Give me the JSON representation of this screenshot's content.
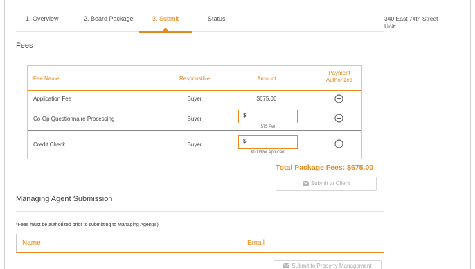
{
  "tabs": [
    {
      "label": "1. Overview",
      "active": false
    },
    {
      "label": "2. Board Package",
      "active": false
    },
    {
      "label": "3. Submit",
      "active": true
    },
    {
      "label": "Status",
      "active": false
    }
  ],
  "fees": {
    "section_title": "Fees",
    "columns": {
      "fee_name": "Fee Name",
      "responsible": "Responsible",
      "amount": "Amount",
      "payment_line1": "Payment",
      "payment_line2": "Authorized"
    },
    "rows": [
      {
        "name": "Application Fee",
        "responsible": "Buyer",
        "amount": "$675.00"
      },
      {
        "name": "Co-Op Questionnaire Processing",
        "responsible": "Buyer",
        "amount_prefix": "$",
        "amount_note": "$75 Per"
      },
      {
        "name": "Credit Check",
        "responsible": "Buyer",
        "amount_prefix": "$",
        "amount_note": "$100/Per Applicant"
      }
    ],
    "total_label": "Total Package Fees: $675.00",
    "submit_client_label": "Submit to Client"
  },
  "agent": {
    "section_title": "Managing Agent Submission",
    "note": "*Fees must be authorized prior to submitting to Managing Agent(s)",
    "columns": {
      "name": "Name",
      "email": "Email"
    },
    "submit_label": "Submit to Property Management"
  },
  "property": {
    "address": "340 East 74th Street",
    "unit_label": "Unit:"
  },
  "colors": {
    "accent": "#e8891f",
    "border": "#c9c9c9",
    "muted_button_text": "#aaaaaa"
  },
  "icons": {
    "payment_toggle": "minus-circle-icon",
    "submit_button": "envelope-icon"
  }
}
